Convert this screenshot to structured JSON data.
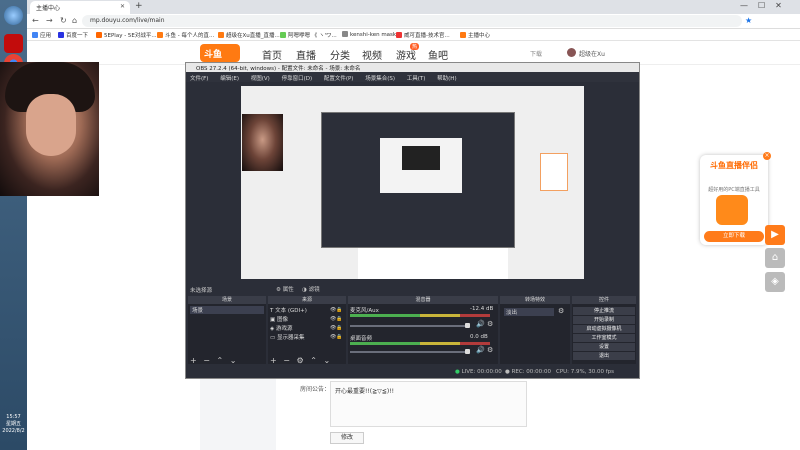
{
  "taskbar": {
    "clock_time": "15:57",
    "clock_day": "星期五",
    "clock_date": "2022/8/2"
  },
  "browser": {
    "tab_title": "主播中心",
    "url": "mp.douyu.com/live/main",
    "bookmarks": [
      "应用",
      "百度一下",
      "5EPlay - 5E对战平...",
      "斗鱼 - 每个人的直...",
      "超级在Xu直播_直播...",
      "阿嗯咿嗯 《 ヽ'ワ...",
      "kenshi-ken mask",
      "威可直播-技术官...",
      "主播中心"
    ]
  },
  "douyu": {
    "logo": "斗鱼",
    "nav": [
      "首页",
      "直播",
      "分类",
      "视频",
      "游戏",
      "鱼吧"
    ],
    "hot_badge": "热",
    "download": "下载",
    "username": "超级在Xu",
    "announcement_label": "房间公告：",
    "announcement_text": "开心最重要!!(≧▽≦)!!",
    "edit_button": "修改",
    "promo": {
      "title": "斗鱼直播伴侣",
      "subtitle": "超好用的PC端直播工具",
      "button": "立即下载"
    }
  },
  "obs": {
    "title": "OBS 27.2.4 (64-bit, windows) - 配置文件: 未命名 - 场景: 未命名",
    "menu": [
      "文件(F)",
      "编辑(E)",
      "视图(V)",
      "停靠窗口(D)",
      "配置文件(P)",
      "场景集合(S)",
      "工具(T)",
      "帮助(H)"
    ],
    "no_source": "未选择源",
    "properties": "属性",
    "filters": "滤镜",
    "docks": {
      "scenes": "场景",
      "sources": "来源",
      "mixer": "混音器",
      "transitions": "转场特效",
      "controls": "控件"
    },
    "scene_items": [
      "场景"
    ],
    "sources": [
      "文本 (GDI+)",
      "图像",
      "游戏源",
      "显示器采集"
    ],
    "mixer": [
      {
        "name": "麦克风/Aux",
        "db": "-12.4 dB"
      },
      {
        "name": "桌面音频",
        "db": "0.0 dB"
      }
    ],
    "transition": "淡出",
    "controls": [
      "停止推流",
      "开始录制",
      "启动虚拟摄像机",
      "工作室模式",
      "设置",
      "退出"
    ],
    "status": {
      "live": "LIVE: 00:00:00",
      "rec": "REC: 00:00:00",
      "cpu": "CPU: 7.9%, 30.00 fps"
    }
  }
}
